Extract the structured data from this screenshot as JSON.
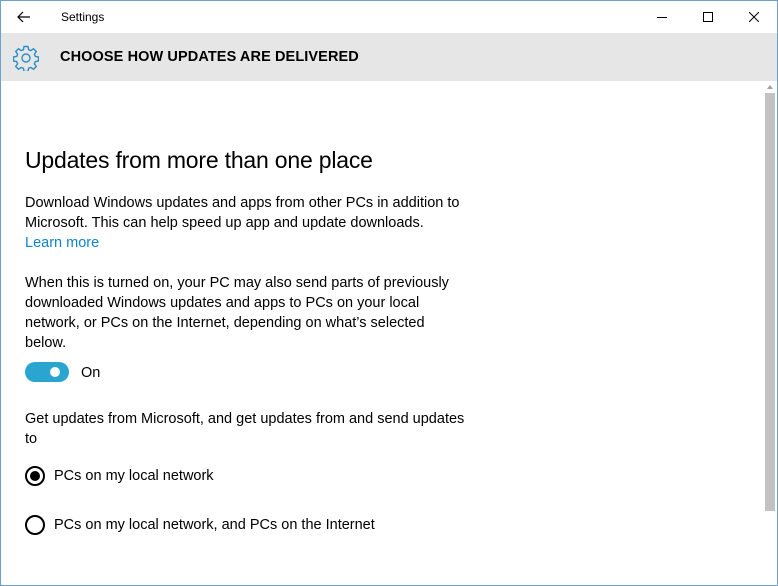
{
  "window": {
    "title": "Settings"
  },
  "header": {
    "title": "CHOOSE HOW UPDATES ARE DELIVERED"
  },
  "main": {
    "heading": "Updates from more than one place",
    "description": "Download Windows updates and apps from other PCs in addition to Microsoft. This can help speed up app and update downloads.",
    "learn_more": "Learn more",
    "toggle_description": "When this is turned on, your PC may also send parts of previously downloaded Windows updates and apps to PCs on your local network, or PCs on the Internet, depending on what’s selected below.",
    "toggle": {
      "state_label": "On",
      "on": true
    },
    "options_prompt": "Get updates from Microsoft, and get updates from and send updates to",
    "options": [
      {
        "label": "PCs on my local network",
        "selected": true
      },
      {
        "label": "PCs on my local network, and PCs on the Internet",
        "selected": false
      }
    ]
  },
  "colors": {
    "accent": "#2aa5cf",
    "link": "#0e86c8",
    "header_band": "#e6e6e6"
  },
  "icons": {
    "back": "back-arrow-icon",
    "minimize": "minimize-icon",
    "maximize": "maximize-icon",
    "close": "close-icon",
    "header": "gear-icon"
  }
}
